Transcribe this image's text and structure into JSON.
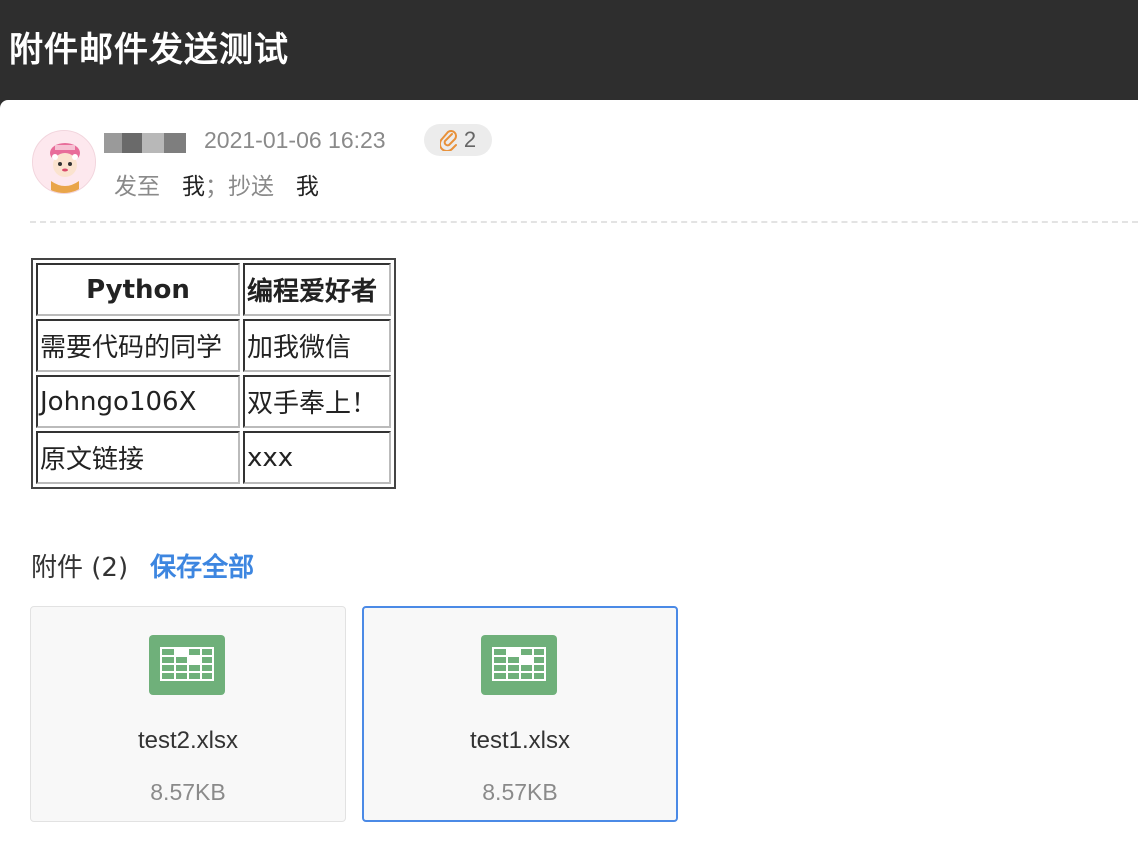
{
  "window": {
    "title": "附件邮件发送测试"
  },
  "message": {
    "date": "2021-01-06 16:23",
    "attachment_count": "2",
    "to_label": "发至",
    "to_value": "我",
    "separator": "；",
    "cc_label": "抄送",
    "cc_value": "我"
  },
  "content_table": {
    "rows": [
      [
        "Python",
        "编程爱好者"
      ],
      [
        "需要代码的同学",
        "加我微信"
      ],
      [
        "Johngo106X",
        "双手奉上！"
      ],
      [
        "原文链接",
        "xxx"
      ]
    ]
  },
  "attachments": {
    "header_label": "附件 (2)",
    "save_all_label": "保存全部",
    "files": [
      {
        "name": "test2.xlsx",
        "size": "8.57KB",
        "icon": "excel-file-icon",
        "selected": false
      },
      {
        "name": "test1.xlsx",
        "size": "8.57KB",
        "icon": "excel-file-icon",
        "selected": true
      }
    ]
  },
  "colors": {
    "titlebar_bg": "#2e2e2e",
    "accent_link": "#3d86e0",
    "excel_green": "#6fb07a",
    "selected_border": "#4b8ae6"
  }
}
